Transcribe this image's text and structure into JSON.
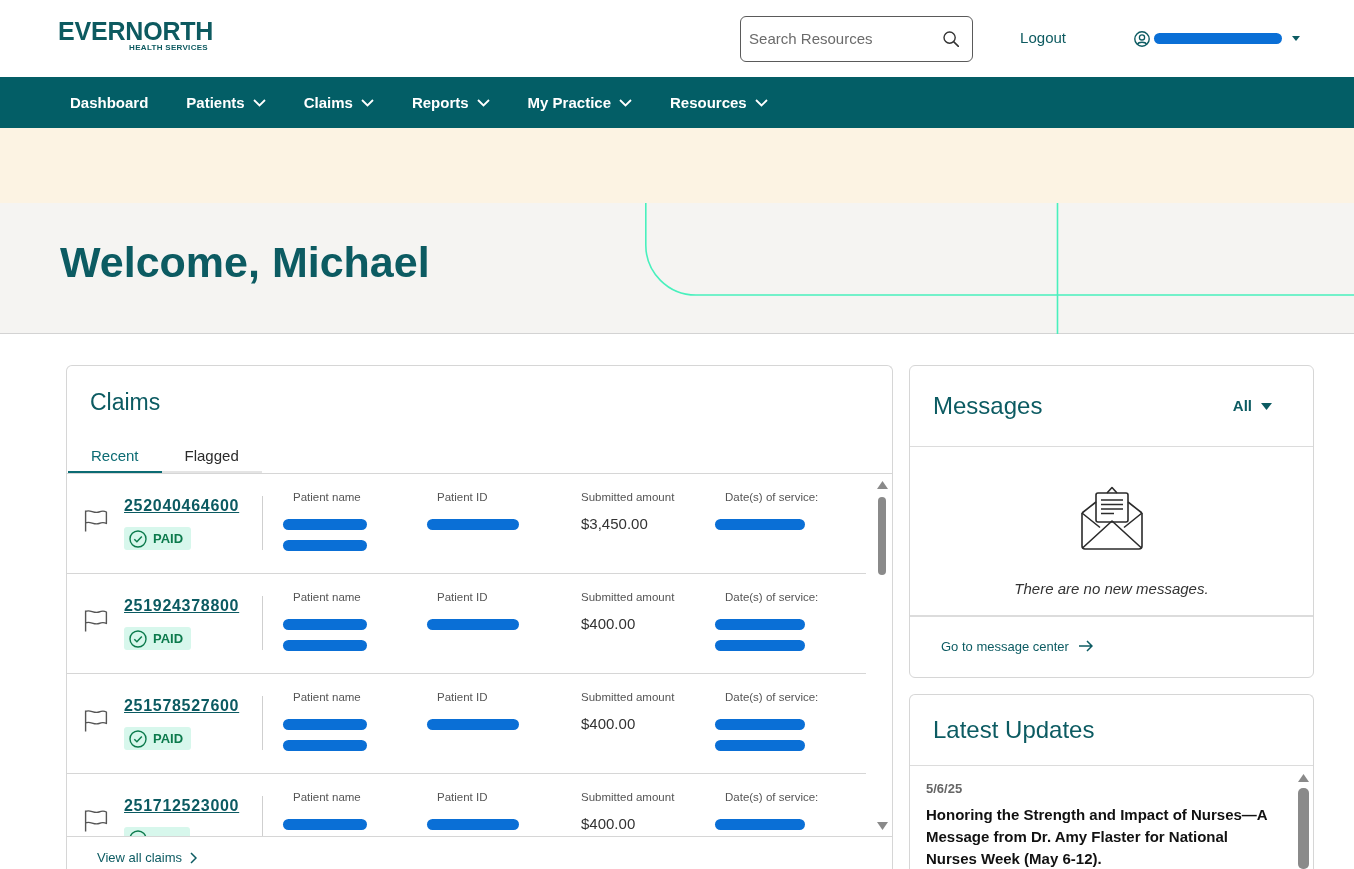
{
  "header": {
    "logo": {
      "wordmark": "EVERNORTH",
      "tagline": "HEALTH SERVICES"
    },
    "search": {
      "placeholder": "Search Resources"
    },
    "logout": "Logout",
    "user_menu": {
      "redacted": true
    }
  },
  "nav": [
    {
      "label": "Dashboard",
      "dropdown": false
    },
    {
      "label": "Patients",
      "dropdown": true
    },
    {
      "label": "Claims",
      "dropdown": true
    },
    {
      "label": "Reports",
      "dropdown": true
    },
    {
      "label": "My Practice",
      "dropdown": true
    },
    {
      "label": "Resources",
      "dropdown": true
    }
  ],
  "welcome": {
    "title": "Welcome, Michael"
  },
  "claims": {
    "title": "Claims",
    "tabs": [
      {
        "label": "Recent",
        "selected": true
      },
      {
        "label": "Flagged",
        "selected": false
      }
    ],
    "rows": [
      {
        "claim_number": "252040464600",
        "flagged": false,
        "status": {
          "label": "PAID",
          "kind": "paid"
        },
        "fields": [
          {
            "label": "Patient name",
            "lines": [
              {
                "redacted": true
              },
              {
                "redacted": true
              }
            ]
          },
          {
            "label": "Patient ID",
            "lines": [
              {
                "redacted": true
              }
            ]
          },
          {
            "label": "Submitted amount",
            "value": "$3,450.00"
          },
          {
            "label": "Date(s) of service:",
            "lines": [
              {
                "redacted": true
              }
            ]
          }
        ]
      },
      {
        "claim_number": "251924378800",
        "flagged": false,
        "status": {
          "label": "PAID",
          "kind": "paid"
        },
        "fields": [
          {
            "label": "Patient name",
            "lines": [
              {
                "redacted": true
              },
              {
                "redacted": true
              }
            ]
          },
          {
            "label": "Patient ID",
            "lines": [
              {
                "redacted": true
              }
            ]
          },
          {
            "label": "Submitted amount",
            "value": "$400.00"
          },
          {
            "label": "Date(s) of service:",
            "lines": [
              {
                "redacted": true
              },
              {
                "redacted": true
              }
            ]
          }
        ]
      },
      {
        "claim_number": "251578527600",
        "flagged": false,
        "status": {
          "label": "PAID",
          "kind": "paid"
        },
        "fields": [
          {
            "label": "Patient name",
            "lines": [
              {
                "redacted": true
              },
              {
                "redacted": true
              }
            ]
          },
          {
            "label": "Patient ID",
            "lines": [
              {
                "redacted": true
              }
            ]
          },
          {
            "label": "Submitted amount",
            "value": "$400.00"
          },
          {
            "label": "Date(s) of service:",
            "lines": [
              {
                "redacted": true
              },
              {
                "redacted": true
              }
            ]
          }
        ]
      },
      {
        "claim_number": "251712523000",
        "flagged": false,
        "status": {
          "kind": "paid"
        },
        "fields": [
          {
            "label": "Patient name",
            "lines": [
              {
                "redacted": true
              }
            ]
          },
          {
            "label": "Patient ID",
            "lines": [
              {
                "redacted": true
              }
            ]
          },
          {
            "label": "Submitted amount",
            "value": "$400.00"
          },
          {
            "label": "Date(s) of service:",
            "lines": [
              {
                "redacted": true
              }
            ]
          }
        ]
      }
    ],
    "footer_link": "View all claims"
  },
  "messages": {
    "title": "Messages",
    "filter": "All",
    "empty_text": "There are no new messages.",
    "link": "Go to message center"
  },
  "latest_updates": {
    "title": "Latest Updates",
    "items": [
      {
        "date": "5/6/25",
        "headline": "Honoring the Strength and Impact of Nurses—A Message from Dr. Amy Flaster for National Nurses Week (May 6-12)."
      }
    ]
  }
}
